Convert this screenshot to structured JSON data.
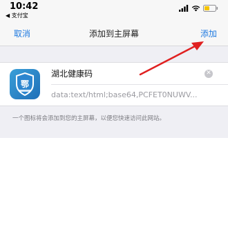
{
  "status_bar": {
    "time": "10:42",
    "back_app": "◀ 支付宝",
    "icons": [
      "signal-icon",
      "wifi-icon",
      "battery-icon"
    ]
  },
  "nav": {
    "cancel_label": "取消",
    "title": "添加到主屏幕",
    "add_label": "添加"
  },
  "shortcut": {
    "icon_glyph": "鄂",
    "icon_name": "health-code-app-icon",
    "name_value": "湖北健康码",
    "url": "data:text/html;base64,PCFET0NUWV..."
  },
  "hint_text": "一个图标将会添加到您的主屏幕，以便您快速访问此网站。",
  "colors": {
    "link_blue": "#1f7ae0",
    "background": "#efeff4",
    "annotation_red": "#e02020"
  }
}
